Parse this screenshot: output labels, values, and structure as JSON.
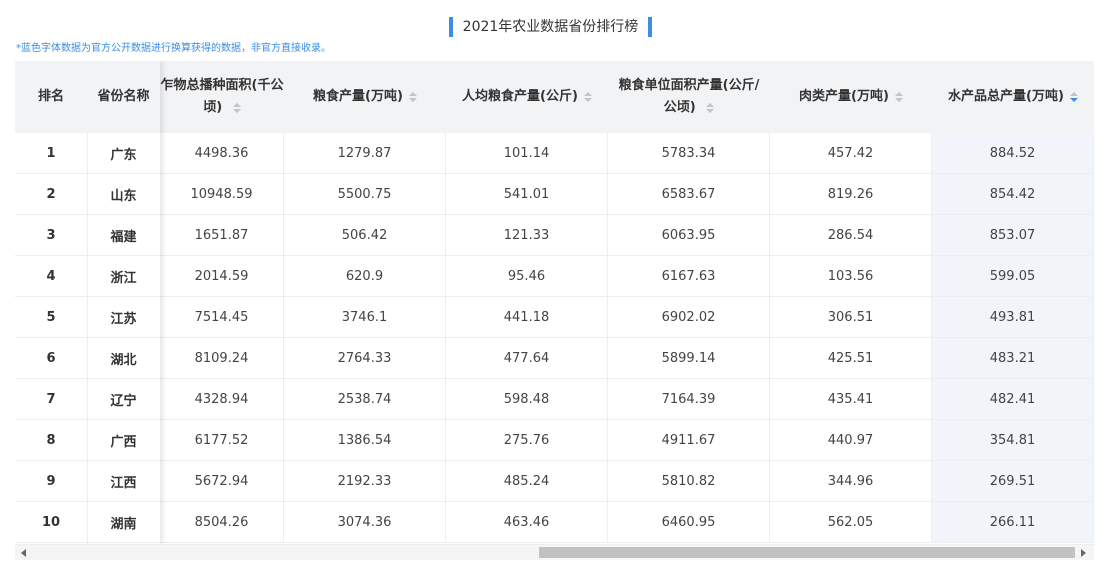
{
  "title": "2021年农业数据省份排行榜",
  "note": "*蓝色字体数据为官方公开数据进行换算获得的数据，非官方直接收录。",
  "columns": {
    "rank": "排名",
    "province": "省份名称",
    "crop_area_line1": "乍物总播种面积(千公",
    "crop_area_line2": "顷)",
    "grain": "粮食产量(万吨)",
    "per_capita": "人均粮食产量(公斤)",
    "yield_line1": "粮食单位面积产量(公斤/",
    "yield_line2": "公顷)",
    "meat": "肉类产量(万吨)",
    "aquatic": "水产品总产量(万吨)"
  },
  "sort": {
    "active_column": "aquatic",
    "direction": "descending"
  },
  "rows": [
    {
      "rank": "1",
      "province": "广东",
      "crop_area": "4498.36",
      "grain": "1279.87",
      "per_capita": "101.14",
      "yield": "5783.34",
      "meat": "457.42",
      "aquatic": "884.52"
    },
    {
      "rank": "2",
      "province": "山东",
      "crop_area": "10948.59",
      "grain": "5500.75",
      "per_capita": "541.01",
      "yield": "6583.67",
      "meat": "819.26",
      "aquatic": "854.42"
    },
    {
      "rank": "3",
      "province": "福建",
      "crop_area": "1651.87",
      "grain": "506.42",
      "per_capita": "121.33",
      "yield": "6063.95",
      "meat": "286.54",
      "aquatic": "853.07"
    },
    {
      "rank": "4",
      "province": "浙江",
      "crop_area": "2014.59",
      "grain": "620.9",
      "per_capita": "95.46",
      "yield": "6167.63",
      "meat": "103.56",
      "aquatic": "599.05"
    },
    {
      "rank": "5",
      "province": "江苏",
      "crop_area": "7514.45",
      "grain": "3746.1",
      "per_capita": "441.18",
      "yield": "6902.02",
      "meat": "306.51",
      "aquatic": "493.81"
    },
    {
      "rank": "6",
      "province": "湖北",
      "crop_area": "8109.24",
      "grain": "2764.33",
      "per_capita": "477.64",
      "yield": "5899.14",
      "meat": "425.51",
      "aquatic": "483.21"
    },
    {
      "rank": "7",
      "province": "辽宁",
      "crop_area": "4328.94",
      "grain": "2538.74",
      "per_capita": "598.48",
      "yield": "7164.39",
      "meat": "435.41",
      "aquatic": "482.41"
    },
    {
      "rank": "8",
      "province": "广西",
      "crop_area": "6177.52",
      "grain": "1386.54",
      "per_capita": "275.76",
      "yield": "4911.67",
      "meat": "440.97",
      "aquatic": "354.81"
    },
    {
      "rank": "9",
      "province": "江西",
      "crop_area": "5672.94",
      "grain": "2192.33",
      "per_capita": "485.24",
      "yield": "5810.82",
      "meat": "344.96",
      "aquatic": "269.51"
    },
    {
      "rank": "10",
      "province": "湖南",
      "crop_area": "8504.26",
      "grain": "3074.36",
      "per_capita": "463.46",
      "yield": "6460.95",
      "meat": "562.05",
      "aquatic": "266.11"
    }
  ]
}
